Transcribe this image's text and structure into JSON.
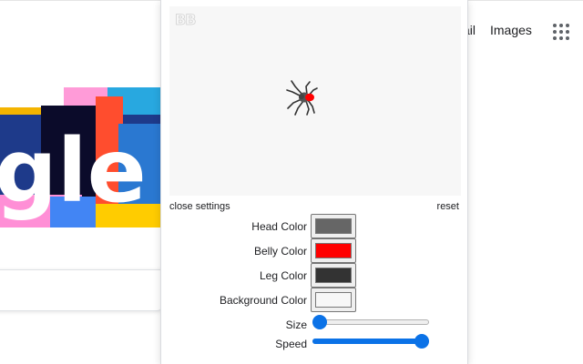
{
  "google": {
    "gmail_link": "Gmail",
    "images_link": "Images",
    "apps_icon": "apps-grid-icon",
    "doodle_text": "gle"
  },
  "popup": {
    "watermark": "BB",
    "close_settings": "close settings",
    "reset": "reset",
    "settings": [
      {
        "label": "Head Color",
        "color": "#666666"
      },
      {
        "label": "Belly Color",
        "color": "#ff0000"
      },
      {
        "label": "Leg Color",
        "color": "#333333"
      },
      {
        "label": "Background Color",
        "color": "#f7f7f7"
      }
    ],
    "sliders": [
      {
        "label": "Size",
        "value": 0
      },
      {
        "label": "Speed",
        "value": 1
      }
    ]
  }
}
